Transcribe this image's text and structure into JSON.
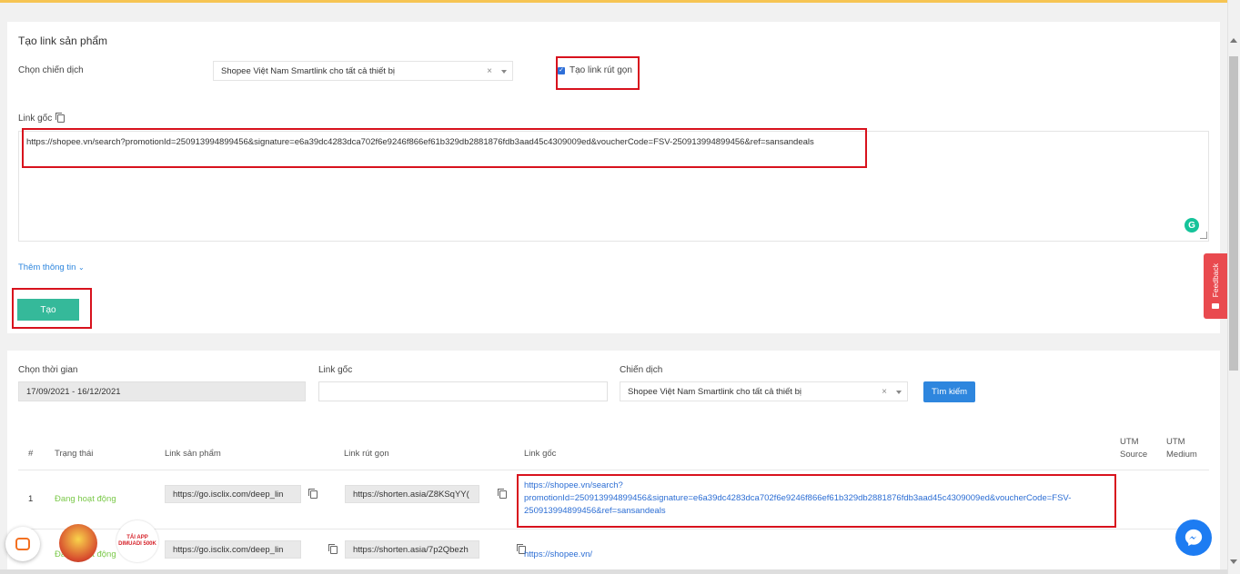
{
  "create_card": {
    "title": "Tạo link sản phẩm",
    "campaign_label": "Chọn chiến dịch",
    "campaign_value": "Shopee Việt Nam Smartlink cho tất cả thiết bị",
    "clear_symbol": "×",
    "shortlink_label": "Tạo link rút gọn",
    "shortlink_checked": true,
    "original_link_label": "Link gốc",
    "original_link_value": "https://shopee.vn/search?promotionId=250913994899456&signature=e6a39dc4283dca702f6e9246f866ef61b329db2881876fdb3aad45c4309009ed&voucherCode=FSV-250913994899456&ref=sansandeals",
    "more_info_label": "Thêm thông tin",
    "create_button": "Tạo"
  },
  "filters": {
    "time_label": "Chọn thời gian",
    "time_value": "17/09/2021 - 16/12/2021",
    "link_label": "Link gốc",
    "link_value": "",
    "campaign_label": "Chiến dịch",
    "campaign_value": "Shopee Việt Nam Smartlink cho tất cả thiết bị",
    "clear_symbol": "×",
    "search_button": "Tìm kiếm"
  },
  "table": {
    "headers": {
      "index": "#",
      "status": "Trạng thái",
      "product_link": "Link sản phẩm",
      "short_link": "Link rút gọn",
      "original_link": "Link gốc",
      "utm_source": "UTM Source",
      "utm_medium": "UTM Medium"
    },
    "rows": [
      {
        "index": "1",
        "status": "Đang hoạt động",
        "product_link": "https://go.isclix.com/deep_lin",
        "short_link": "https://shorten.asia/Z8KSqYY(",
        "original_link_line1": "https://shopee.vn/search?",
        "original_link_line2": "promotionId=250913994899456&signature=e6a39dc4283dca702f6e9246f866ef61b329db2881876fdb3aad45c4309009ed&voucherCode=FSV-",
        "original_link_line3": "250913994899456&ref=sansandeals"
      },
      {
        "index": "",
        "status": "Đang hoạt động",
        "product_link": "https://go.isclix.com/deep_lin",
        "short_link": "https://shorten.asia/7p2Qbezh",
        "original_link_line1": "https://shopee.vn/"
      }
    ]
  },
  "widgets": {
    "feedback_label": "Feedback",
    "grammarly_letter": "G",
    "promo_text": "TẢI APP DIMUADI 500K"
  },
  "colors": {
    "accent_green": "#35b99a",
    "search_blue": "#2e86de",
    "link_blue": "#2c6ed4",
    "status_green": "#7bc94a",
    "highlight_red": "#d8121d",
    "feedback_red": "#e94a4f"
  }
}
